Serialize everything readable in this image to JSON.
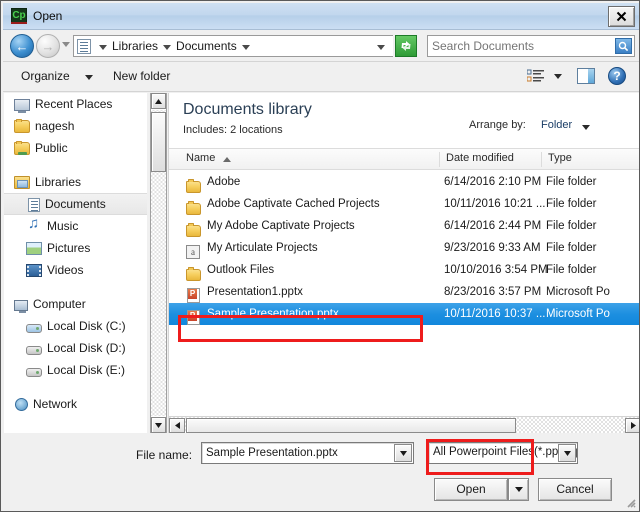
{
  "window": {
    "title": "Open",
    "app_icon": "captivate-cp-icon",
    "close_label": "✕"
  },
  "nav": {
    "back_icon": "back-arrow-icon",
    "forward_icon": "forward-arrow-icon",
    "back_glyph": "←",
    "forward_glyph": "→",
    "history_icon": "history-dropdown-icon",
    "breadcrumb": [
      "Libraries",
      "Documents"
    ],
    "refresh_icon": "refresh-icon",
    "refresh_glyph": "↻"
  },
  "search": {
    "placeholder": "Search Documents",
    "value": "",
    "icon": "search-magnifier-icon"
  },
  "toolbar": {
    "organize_label": "Organize",
    "new_folder_label": "New folder",
    "view_icon": "view-mode-icon",
    "preview_pane_icon": "preview-pane-icon",
    "help_icon": "help-icon",
    "help_glyph": "?"
  },
  "sidebar": {
    "items": [
      {
        "label": "Recent Places",
        "icon": "recent-places-icon",
        "indent": false,
        "selected": false,
        "gap_before": false
      },
      {
        "label": "nagesh",
        "icon": "folder-icon",
        "indent": false,
        "selected": false,
        "gap_before": false
      },
      {
        "label": "Public",
        "icon": "public-folder-icon",
        "indent": false,
        "selected": false,
        "gap_before": false
      },
      {
        "label": "Libraries",
        "icon": "libraries-icon",
        "indent": false,
        "selected": false,
        "gap_before": true
      },
      {
        "label": "Documents",
        "icon": "documents-icon",
        "indent": true,
        "selected": true,
        "gap_before": false
      },
      {
        "label": "Music",
        "icon": "music-icon",
        "indent": true,
        "selected": false,
        "gap_before": false
      },
      {
        "label": "Pictures",
        "icon": "pictures-icon",
        "indent": true,
        "selected": false,
        "gap_before": false
      },
      {
        "label": "Videos",
        "icon": "videos-icon",
        "indent": true,
        "selected": false,
        "gap_before": false
      },
      {
        "label": "Computer",
        "icon": "computer-icon",
        "indent": false,
        "selected": false,
        "gap_before": true
      },
      {
        "label": "Local Disk (C:)",
        "icon": "drive-c-icon",
        "indent": true,
        "selected": false,
        "gap_before": false
      },
      {
        "label": "Local Disk (D:)",
        "icon": "drive-icon",
        "indent": true,
        "selected": false,
        "gap_before": false
      },
      {
        "label": "Local Disk (E:)",
        "icon": "drive-icon",
        "indent": true,
        "selected": false,
        "gap_before": false
      },
      {
        "label": "Network",
        "icon": "network-icon",
        "indent": false,
        "selected": false,
        "gap_before": true
      }
    ]
  },
  "library": {
    "title": "Documents library",
    "includes": "Includes:  2 locations",
    "arrange_label": "Arrange by:",
    "arrange_value": "Folder"
  },
  "columns": {
    "name": "Name",
    "date_modified": "Date modified",
    "type": "Type",
    "sorted_by": "Name",
    "sort_direction": "ascending"
  },
  "files": [
    {
      "name": "Adobe",
      "date": "6/14/2016 2:10 PM",
      "type": "File folder",
      "icon": "folder-icon",
      "selected": false
    },
    {
      "name": "Adobe Captivate Cached Projects",
      "date": "10/11/2016 10:21 ...",
      "type": "File folder",
      "icon": "folder-icon",
      "selected": false
    },
    {
      "name": "My Adobe Captivate Projects",
      "date": "6/14/2016 2:44 PM",
      "type": "File folder",
      "icon": "folder-icon",
      "selected": false
    },
    {
      "name": "My Articulate Projects",
      "date": "9/23/2016 9:33 AM",
      "type": "File folder",
      "icon": "articulate-folder-icon",
      "selected": false
    },
    {
      "name": "Outlook Files",
      "date": "10/10/2016 3:54 PM",
      "type": "File folder",
      "icon": "folder-icon",
      "selected": false
    },
    {
      "name": "Presentation1.pptx",
      "date": "8/23/2016 3:57 PM",
      "type": "Microsoft Po",
      "icon": "powerpoint-icon",
      "selected": false
    },
    {
      "name": "Sample Presentation.pptx",
      "date": "10/11/2016 10:37 ...",
      "type": "Microsoft Po",
      "icon": "powerpoint-icon",
      "selected": true
    }
  ],
  "footer": {
    "file_name_label": "File name:",
    "file_name_value": "Sample Presentation.pptx",
    "filter_value": "All Powerpoint Files(*.ppt, *.pps",
    "open_label": "Open",
    "cancel_label": "Cancel",
    "dropdown_glyph": "▼"
  },
  "annotations": {
    "highlight_color": "#ee1c1c",
    "boxes": [
      "selected-file-row",
      "open-button"
    ]
  },
  "scroll": {
    "up_glyph": "▲",
    "down_glyph": "▼",
    "left_glyph": "◀",
    "right_glyph": "▶"
  }
}
